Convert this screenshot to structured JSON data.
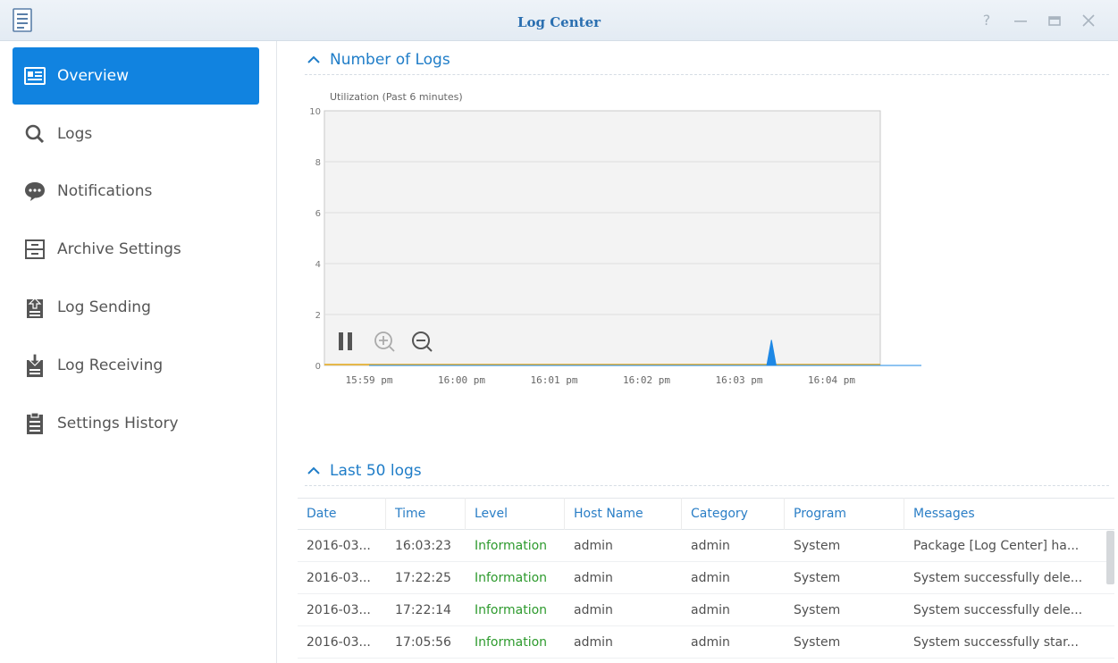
{
  "window": {
    "title": "Log Center",
    "controls": [
      "help-icon",
      "minimize-icon",
      "maximize-icon",
      "close-icon"
    ]
  },
  "sidebar": {
    "items": [
      {
        "label": "Overview",
        "icon": "overview-card-icon",
        "active": true
      },
      {
        "label": "Logs",
        "icon": "search-icon"
      },
      {
        "label": "Notifications",
        "icon": "chat-bubble-icon"
      },
      {
        "label": "Archive Settings",
        "icon": "archive-cabinet-icon"
      },
      {
        "label": "Log Sending",
        "icon": "upload-clipboard-icon"
      },
      {
        "label": "Log Receiving",
        "icon": "download-clipboard-icon"
      },
      {
        "label": "Settings History",
        "icon": "history-clipboard-icon"
      }
    ]
  },
  "sections": {
    "number_of_logs": "Number of Logs",
    "last_50_logs": "Last 50 logs"
  },
  "chart_caption": "Utilization (Past 6 minutes)",
  "chart_controls": [
    "pause-icon",
    "zoom-in-icon",
    "zoom-out-icon"
  ],
  "chart_data": {
    "type": "area",
    "title": "Utilization (Past 6 minutes)",
    "categories": [
      "15:59 pm",
      "16:00 pm",
      "16:01 pm",
      "16:02 pm",
      "16:03 pm",
      "16:04 pm"
    ],
    "ylim": [
      0,
      10
    ],
    "yticks": [
      0,
      2,
      4,
      6,
      8,
      10
    ],
    "grid": true,
    "series": [
      {
        "points": [
          [
            0,
            0
          ],
          [
            4.3,
            0
          ],
          [
            4.35,
            1
          ],
          [
            4.4,
            0
          ],
          [
            6,
            0
          ]
        ],
        "color": "#1e88e5"
      }
    ],
    "baseline_color": "#e6b84a"
  },
  "table": {
    "columns": [
      "Date",
      "Time",
      "Level",
      "Host Name",
      "Category",
      "Program",
      "Messages"
    ],
    "rows": [
      [
        "2016-03...",
        "16:03:23",
        "Information",
        "admin",
        "admin",
        "System",
        "Package [Log Center] ha..."
      ],
      [
        "2016-03...",
        "17:22:25",
        "Information",
        "admin",
        "admin",
        "System",
        "System successfully dele..."
      ],
      [
        "2016-03...",
        "17:22:14",
        "Information",
        "admin",
        "admin",
        "System",
        "System successfully dele..."
      ],
      [
        "2016-03...",
        "17:05:56",
        "Information",
        "admin",
        "admin",
        "System",
        "System successfully star..."
      ]
    ]
  },
  "colors": {
    "accent": "#1183e0",
    "title_blue": "#2a6fb0",
    "level_info": "#2d9a2d"
  }
}
